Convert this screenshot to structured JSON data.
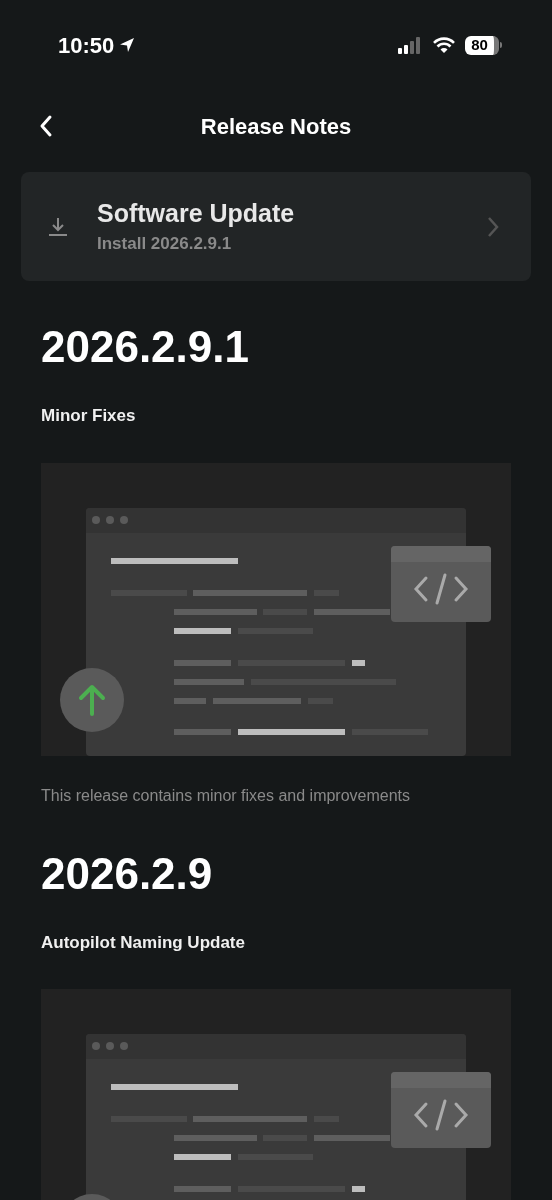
{
  "status_bar": {
    "time": "10:50",
    "battery": "80"
  },
  "header": {
    "title": "Release Notes"
  },
  "update_card": {
    "title": "Software Update",
    "subtitle": "Install 2026.2.9.1"
  },
  "releases": [
    {
      "version": "2026.2.9.1",
      "heading": "Minor Fixes",
      "description": "This release contains minor fixes and improvements"
    },
    {
      "version": "2026.2.9",
      "heading": "Autopilot Naming Update"
    }
  ]
}
